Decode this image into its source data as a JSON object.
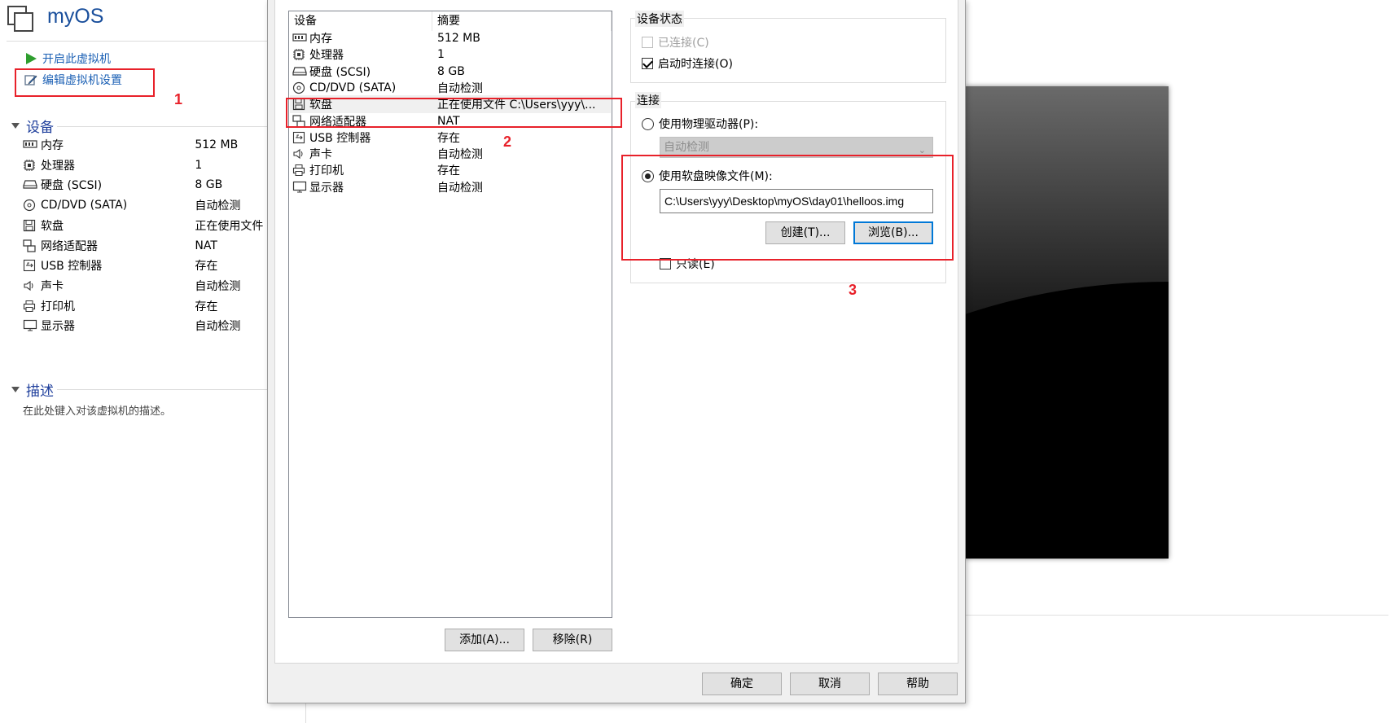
{
  "vm": {
    "title": "myOS",
    "actions": {
      "start": "开启此虚拟机",
      "edit": "编辑虚拟机设置"
    },
    "devices_section": "设备",
    "devices": [
      {
        "icon": "memory-icon",
        "name": "内存",
        "value": "512 MB"
      },
      {
        "icon": "processor-icon",
        "name": "处理器",
        "value": "1"
      },
      {
        "icon": "harddisk-icon",
        "name": "硬盘 (SCSI)",
        "value": "8 GB"
      },
      {
        "icon": "cdrom-icon",
        "name": "CD/DVD (SATA)",
        "value": "自动检测"
      },
      {
        "icon": "floppy-icon",
        "name": "软盘",
        "value": "正在使用文件"
      },
      {
        "icon": "network-icon",
        "name": "网络适配器",
        "value": "NAT"
      },
      {
        "icon": "usb-icon",
        "name": "USB 控制器",
        "value": "存在"
      },
      {
        "icon": "sound-icon",
        "name": "声卡",
        "value": "自动检测"
      },
      {
        "icon": "printer-icon",
        "name": "打印机",
        "value": "存在"
      },
      {
        "icon": "display-icon",
        "name": "显示器",
        "value": "自动检测"
      }
    ],
    "description_section": "描述",
    "description_placeholder": "在此处键入对该虚拟机的描述。"
  },
  "dialog": {
    "list_headers": {
      "device": "设备",
      "summary": "摘要"
    },
    "list": [
      {
        "icon": "memory-icon",
        "name": "内存",
        "summary": "512 MB"
      },
      {
        "icon": "processor-icon",
        "name": "处理器",
        "summary": "1"
      },
      {
        "icon": "harddisk-icon",
        "name": "硬盘 (SCSI)",
        "summary": "8 GB"
      },
      {
        "icon": "cdrom-icon",
        "name": "CD/DVD (SATA)",
        "summary": "自动检测"
      },
      {
        "icon": "floppy-icon",
        "name": "软盘",
        "summary": "正在使用文件 C:\\Users\\yyy\\...",
        "selected": true
      },
      {
        "icon": "network-icon",
        "name": "网络适配器",
        "summary": "NAT"
      },
      {
        "icon": "usb-icon",
        "name": "USB 控制器",
        "summary": "存在"
      },
      {
        "icon": "sound-icon",
        "name": "声卡",
        "summary": "自动检测"
      },
      {
        "icon": "printer-icon",
        "name": "打印机",
        "summary": "存在"
      },
      {
        "icon": "display-icon",
        "name": "显示器",
        "summary": "自动检测"
      }
    ],
    "add_button": "添加(A)...",
    "remove_button": "移除(R)",
    "status_group": "设备状态",
    "connected": {
      "label": "已连接(C)",
      "checked": false,
      "disabled": true
    },
    "connect_at_power_on": {
      "label": "启动时连接(O)",
      "checked": true
    },
    "connection_group": "连接",
    "physical_drive": {
      "label": "使用物理驱动器(P):",
      "selected": false,
      "combo_value": "自动检测"
    },
    "image_file": {
      "label": "使用软盘映像文件(M):",
      "selected": true,
      "path": "C:\\Users\\yyy\\Desktop\\myOS\\day01\\helloos.img"
    },
    "create_button": "创建(T)...",
    "browse_button": "浏览(B)...",
    "readonly": {
      "label": "只读(E)",
      "checked": false
    },
    "ok_button": "确定",
    "cancel_button": "取消",
    "help_button": "帮助"
  },
  "annotations": {
    "n1": "1",
    "n2": "2",
    "n3": "3"
  },
  "colors": {
    "annotation": "#e8212a",
    "link": "#1a5fb4",
    "section": "#1f3f9c",
    "focus": "#0078d7"
  }
}
